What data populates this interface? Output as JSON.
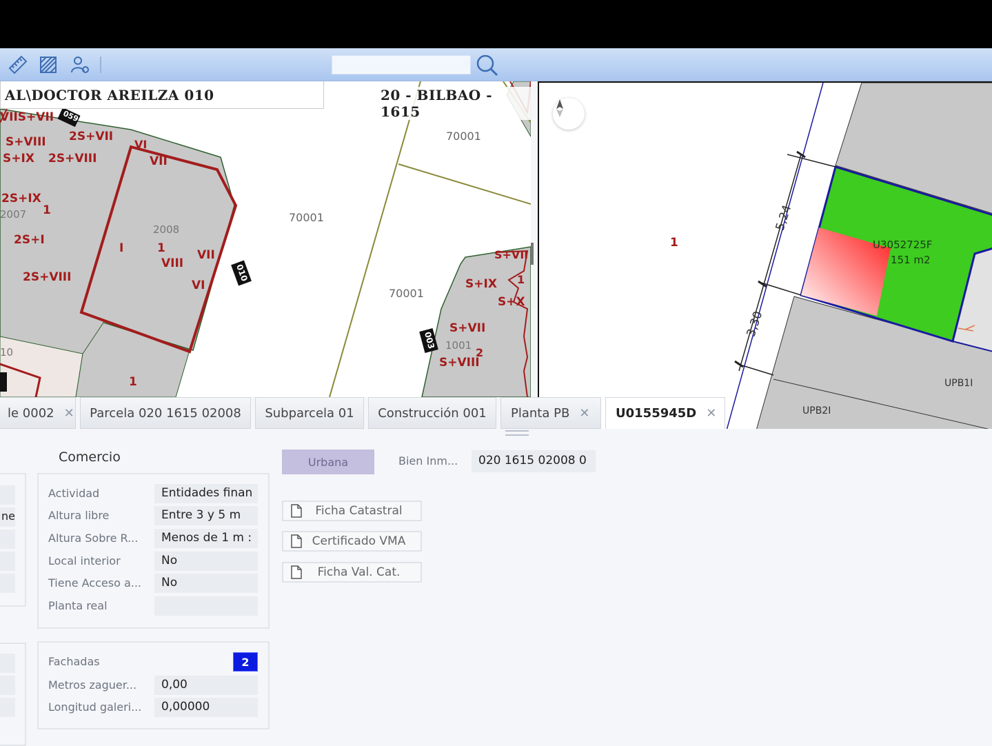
{
  "toolbar": {
    "icons": [
      "ruler-icon",
      "hatch-icon",
      "user-settings-icon",
      "search-icon"
    ],
    "search_placeholder": ""
  },
  "map_left": {
    "address": "AL\\DOCTOR AREILZA 010",
    "municipality": "20 - BILBAO - 1615",
    "labels": {
      "vii_s_vii": "VIIS+VII",
      "s_viii": "S+VIII",
      "s_ix": "S+IX",
      "two_s_vii": "2S+VII",
      "two_s_viii_a": "2S+VIII",
      "vi_a": "VI",
      "vii_a": "VII",
      "two_s_ix": "2S+IX",
      "y2007": "2007",
      "one_a": "1",
      "two_s_i": "2S+I",
      "two_s_viii_b": "2S+VIII",
      "y2008": "2008",
      "i_a": "I",
      "one_b": "1",
      "viii": "VIII",
      "vii_b": "VII",
      "vi_b": "VI",
      "ten": "10",
      "one_c": "1",
      "p70001_a": "70001",
      "p70001_b": "70001",
      "p70001_c": "70001",
      "s_vii_r": "S+VII",
      "s_ix_r": "S+IX",
      "one_r": "1",
      "s_x_r": "S+X",
      "s_vii_b": "S+VII",
      "y1001": "1001",
      "two_r": "2",
      "s_viii_r": "S+VIII"
    },
    "portal_tags": [
      "059",
      "010",
      "003"
    ]
  },
  "map_right": {
    "label_one": "1",
    "dim_top": "5,24",
    "dim_bottom": "3,30",
    "unit_ref": "U3052725F",
    "area": "151 m2",
    "upb1": "UPB1I",
    "upb2": "UPB2I"
  },
  "tabs": [
    {
      "label": "le 0002",
      "closable": true
    },
    {
      "label": "Parcela 020 1615 02008",
      "closable": false
    },
    {
      "label": "Subparcela 01",
      "closable": false
    },
    {
      "label": "Construcción 001",
      "closable": false
    },
    {
      "label": "Planta PB",
      "closable": true
    },
    {
      "label": "U0155945D",
      "closable": true,
      "active": true
    }
  ],
  "panel": {
    "section_title": "Comercio",
    "stub_fragment": "ne",
    "fields": [
      {
        "label": "Actividad",
        "value": "Entidades finan"
      },
      {
        "label": "Altura libre",
        "value": "Entre 3 y 5 m"
      },
      {
        "label": "Altura Sobre R...",
        "value": "Menos de 1 m :"
      },
      {
        "label": "Local interior",
        "value": "No"
      },
      {
        "label": "Tiene Acceso a...",
        "value": "No"
      },
      {
        "label": "Planta real",
        "value": ""
      }
    ],
    "fachadas": {
      "label": "Fachadas",
      "count": "2",
      "fields": [
        {
          "label": "Metros zaguer...",
          "value": "0,00"
        },
        {
          "label": "Longitud galeri...",
          "value": "0,00000"
        }
      ]
    },
    "urbana_label": "Urbana",
    "bien_label": "Bien Inm...",
    "bien_value": "020 1615 02008 0",
    "doc_buttons": [
      "Ficha Catastral",
      "Certificado VMA",
      "Ficha Val. Cat."
    ]
  },
  "colors": {
    "parcel_red": "#a31c1c",
    "building_gray": "#c8c8c8",
    "selected_green": "#3dcc1f",
    "selected_border": "#1a1aa0",
    "fachadas_badge": "#0b1be0",
    "urbana_bg": "#c4bedf"
  }
}
